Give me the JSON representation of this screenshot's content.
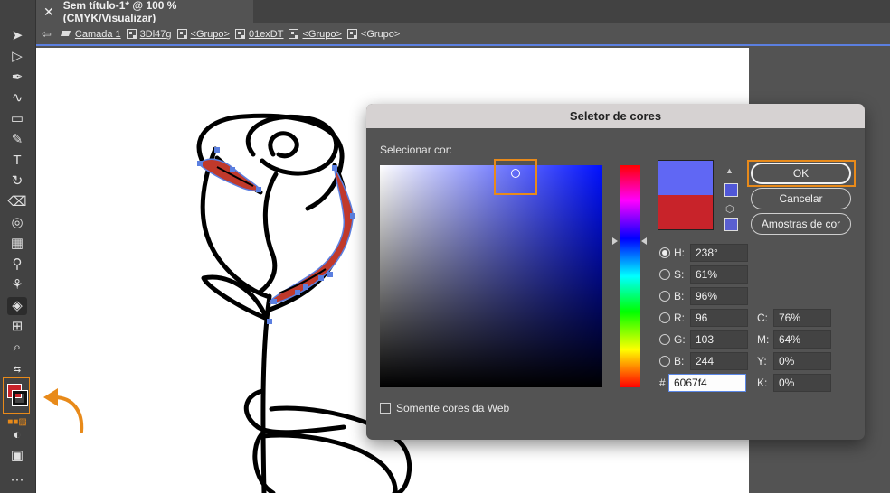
{
  "document_tab": {
    "close_glyph": "✕",
    "title": "Sem título-1* @ 100 % (CMYK/Visualizar)"
  },
  "breadcrumb": {
    "items": [
      {
        "label": "Camada 1",
        "icon": "layers-icon"
      },
      {
        "label": "3Dl47g",
        "icon": "group-icon"
      },
      {
        "label": "<Grupo>",
        "icon": "group-icon"
      },
      {
        "label": "01exDT",
        "icon": "group-icon"
      },
      {
        "label": "<Grupo>",
        "icon": "group-icon"
      },
      {
        "label": "<Grupo>",
        "icon": "group-icon"
      }
    ]
  },
  "toolbar": {
    "tools": [
      "selection-tool",
      "direct-selection-tool",
      "pen-tool",
      "curvature-tool",
      "rectangle-tool",
      "paintbrush-tool",
      "type-tool",
      "rotate-tool",
      "eraser-tool",
      "warp-tool",
      "gradient-tool",
      "eyedropper-tool",
      "shape-builder-tool",
      "live-paint-tool",
      "artboard-tool",
      "zoom-tool"
    ],
    "fill_color": "#c8232a",
    "stroke_color": "#111111"
  },
  "dialog": {
    "title": "Seletor de cores",
    "select_label": "Selecionar cor:",
    "new_color": "#6067f4",
    "old_color": "#c8232a",
    "hsb": [
      {
        "label": "H:",
        "value": "238°",
        "selected": true
      },
      {
        "label": "S:",
        "value": "61%",
        "selected": false
      },
      {
        "label": "B:",
        "value": "96%",
        "selected": false
      }
    ],
    "rgb": [
      {
        "label": "R:",
        "value": "96"
      },
      {
        "label": "G:",
        "value": "103"
      },
      {
        "label": "B:",
        "value": "244"
      }
    ],
    "hex_label": "#",
    "hex_value": "6067f4",
    "cmyk": [
      {
        "label": "C:",
        "value": "76%"
      },
      {
        "label": "M:",
        "value": "64%"
      },
      {
        "label": "Y:",
        "value": "0%"
      },
      {
        "label": "K:",
        "value": "0%"
      }
    ],
    "web_only_label": "Somente cores da Web",
    "buttons": {
      "ok": "OK",
      "cancel": "Cancelar",
      "swatches": "Amostras de cor"
    }
  },
  "colors": {
    "highlight": "#e88a1a",
    "selection_blue": "#5b7fe0"
  }
}
